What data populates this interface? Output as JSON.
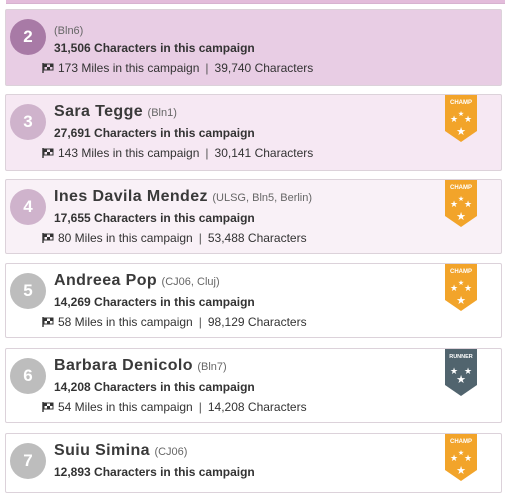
{
  "leaderboard": {
    "entries": [
      {
        "rank": "2",
        "name": "",
        "group": "(Bln6)",
        "characters": "31,506 Characters in this campaign",
        "miles": "173 Miles in this campaign",
        "sep": "|",
        "total": "39,740 Characters",
        "badge": null
      },
      {
        "rank": "3",
        "name": "Sara Tegge",
        "group": "(Bln1)",
        "characters": "27,691 Characters in this campaign",
        "miles": "143 Miles in this campaign",
        "sep": "|",
        "total": "30,141 Characters",
        "badge": "CHAMP"
      },
      {
        "rank": "4",
        "name": "Ines Davila Mendez",
        "group": "(ULSG, Bln5, Berlin)",
        "characters": "17,655 Characters in this campaign",
        "miles": "80 Miles in this campaign",
        "sep": "|",
        "total": "53,488 Characters",
        "badge": "CHAMP"
      },
      {
        "rank": "5",
        "name": "Andreea Pop",
        "group": "(CJ06, Cluj)",
        "characters": "14,269 Characters in this campaign",
        "miles": "58 Miles in this campaign",
        "sep": "|",
        "total": "98,129 Characters",
        "badge": "CHAMP"
      },
      {
        "rank": "6",
        "name": "Barbara Denicolo",
        "group": "(Bln7)",
        "characters": "14,208 Characters in this campaign",
        "miles": "54 Miles in this campaign",
        "sep": "|",
        "total": "14,208 Characters",
        "badge": "RUNNER"
      },
      {
        "rank": "7",
        "name": "Suiu Simina",
        "group": "(CJ06)",
        "characters": "12,893 Characters in this campaign",
        "miles": "",
        "sep": "",
        "total": "",
        "badge": "CHAMP"
      }
    ]
  },
  "icons": {
    "stats": "flag-icon",
    "champ_badge": "champ-badge-icon",
    "runner_badge": "runner-badge-icon"
  },
  "colors": {
    "champ_badge": "#f2a42a",
    "runner_badge": "#51646e",
    "highlight_row": "#e8cde4",
    "rank_top": "#a87aa6",
    "rank_default": "#bdbdbd"
  }
}
